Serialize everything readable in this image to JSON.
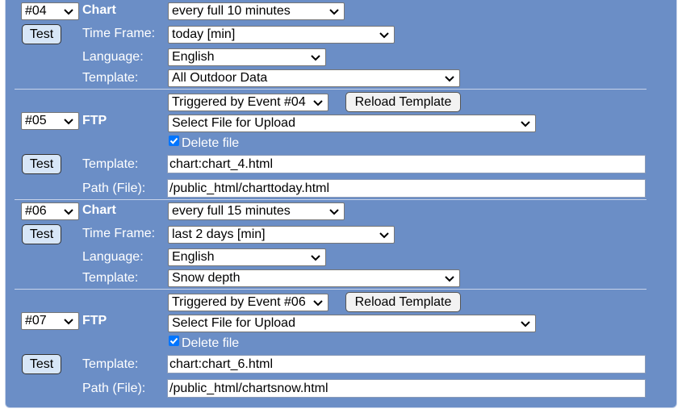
{
  "blocks": [
    {
      "type": "chart",
      "id": "#04",
      "kind_label": "Chart",
      "interval": "every full 10 minutes",
      "test_label": "Test",
      "timeframe_label": "Time Frame:",
      "timeframe": "today [min]",
      "language_label": "Language:",
      "language": "English",
      "template_label": "Template:",
      "template": "All Outdoor Data"
    },
    {
      "type": "ftp",
      "id": "#05",
      "kind_label": "FTP",
      "trigger": "Triggered by Event #04",
      "reload_label": "Reload Template",
      "file_select": "Select File for Upload",
      "delete_label": "Delete file",
      "delete_checked": true,
      "test_label": "Test",
      "template_label": "Template:",
      "template": "chart:chart_4.html",
      "path_label": "Path (File):",
      "path": "/public_html/charttoday.html"
    },
    {
      "type": "chart",
      "id": "#06",
      "kind_label": "Chart",
      "interval": "every full 15 minutes",
      "test_label": "Test",
      "timeframe_label": "Time Frame:",
      "timeframe": "last 2 days [min]",
      "language_label": "Language:",
      "language": "English",
      "template_label": "Template:",
      "template": "Snow depth"
    },
    {
      "type": "ftp",
      "id": "#07",
      "kind_label": "FTP",
      "trigger": "Triggered by Event #06",
      "reload_label": "Reload Template",
      "file_select": "Select File for Upload",
      "delete_label": "Delete file",
      "delete_checked": true,
      "test_label": "Test",
      "template_label": "Template:",
      "template": "chart:chart_6.html",
      "path_label": "Path (File):",
      "path": "/public_html/chartsnow.html"
    }
  ],
  "colors": {
    "panel": "#6b8ec6",
    "test_button": "#d7e6f7",
    "checkbox": "#0075ff"
  }
}
